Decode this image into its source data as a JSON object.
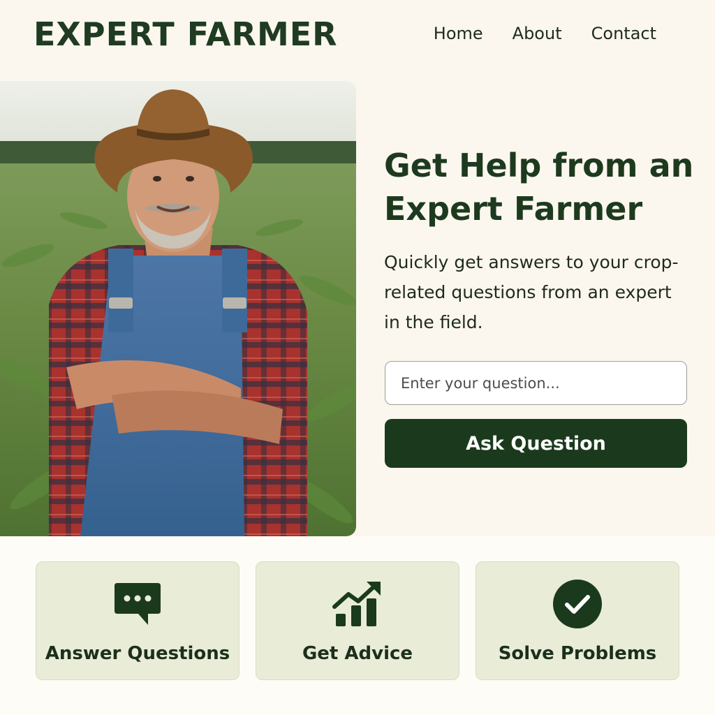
{
  "header": {
    "brand": "EXPERT FARMER",
    "nav": [
      "Home",
      "About",
      "Contact"
    ]
  },
  "hero": {
    "headline": "Get Help from an Expert Farmer",
    "subtext": "Quickly get answers to your crop-related questions from an expert in the field.",
    "input_placeholder": "Enter your question...",
    "button_label": "Ask Question"
  },
  "features": [
    {
      "label": "Answer Questions",
      "icon": "chat-bubble-icon"
    },
    {
      "label": "Get Advice",
      "icon": "growth-chart-icon"
    },
    {
      "label": "Solve Problems",
      "icon": "check-circle-icon"
    }
  ],
  "colors": {
    "background": "#fbf7ee",
    "brand_green": "#1b3a1d",
    "card_bg": "#e9ecd7"
  }
}
